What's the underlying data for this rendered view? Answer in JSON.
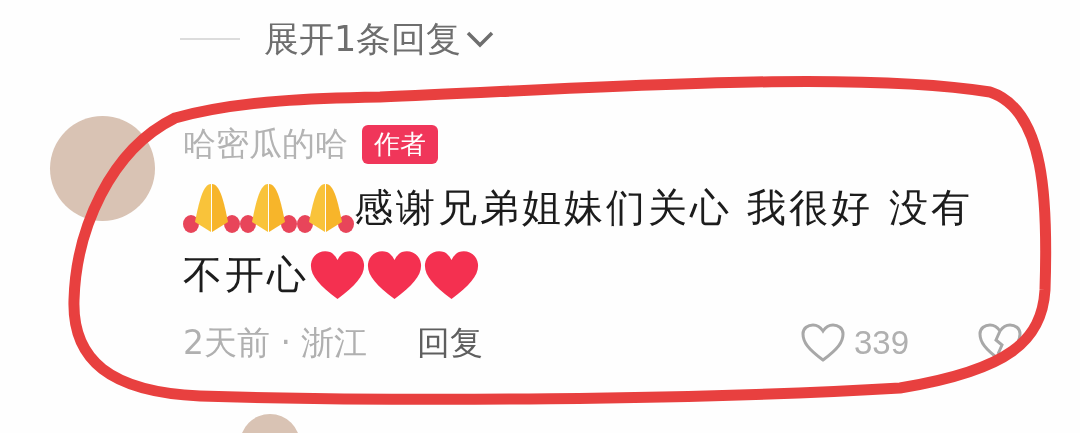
{
  "expand_replies": {
    "label": "展开1条回复"
  },
  "comment": {
    "author": "哈密瓜的哈",
    "badge": "作者",
    "body_lines": [
      [
        {
          "kind": "praying-hands"
        },
        {
          "kind": "praying-hands"
        },
        {
          "kind": "praying-hands"
        },
        {
          "kind": "text",
          "text": "感谢兄弟姐妹们关心 我很好 没有"
        }
      ],
      [
        {
          "kind": "text",
          "text": "不开心"
        },
        {
          "kind": "heart"
        },
        {
          "kind": "heart"
        },
        {
          "kind": "heart"
        }
      ]
    ],
    "meta": "2天前 · 浙江",
    "reply": "回复",
    "likes": "339",
    "liked": false
  }
}
